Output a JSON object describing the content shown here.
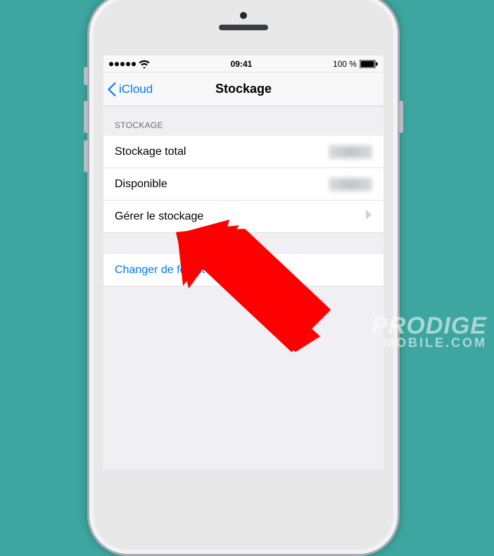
{
  "statusbar": {
    "time": "09:41",
    "battery_text": "100 %"
  },
  "nav": {
    "back_label": "iCloud",
    "title": "Stockage"
  },
  "section": {
    "header": "STOCKAGE",
    "rows": {
      "total": {
        "label": "Stockage total"
      },
      "available": {
        "label": "Disponible"
      },
      "manage": {
        "label": "Gérer le stockage"
      }
    },
    "change_plan": "Changer de forfait de stockage"
  },
  "watermark": {
    "line1": "PRODIGE",
    "line2": "MOBILE.COM"
  }
}
